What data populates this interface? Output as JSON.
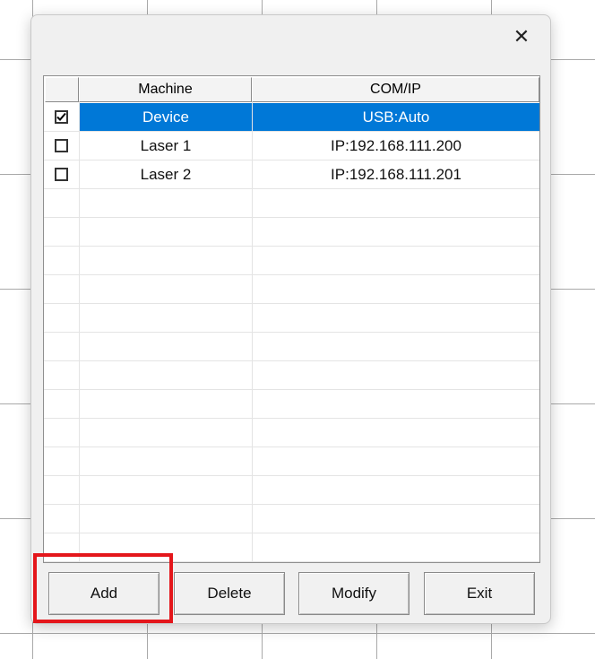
{
  "dialog": {
    "close_glyph": "✕"
  },
  "table": {
    "headers": [
      "",
      "Machine",
      "COM/IP"
    ],
    "rows": [
      {
        "checked": true,
        "machine": "Device",
        "com_ip": "USB:Auto",
        "selected": true
      },
      {
        "checked": false,
        "machine": "Laser 1",
        "com_ip": "IP:192.168.111.200",
        "selected": false
      },
      {
        "checked": false,
        "machine": "Laser 2",
        "com_ip": "IP:192.168.111.201",
        "selected": false
      }
    ]
  },
  "buttons": {
    "add": "Add",
    "delete": "Delete",
    "modify": "Modify",
    "exit": "Exit"
  },
  "colors": {
    "selection": "#0078d7",
    "highlight_box": "#e4161b"
  }
}
